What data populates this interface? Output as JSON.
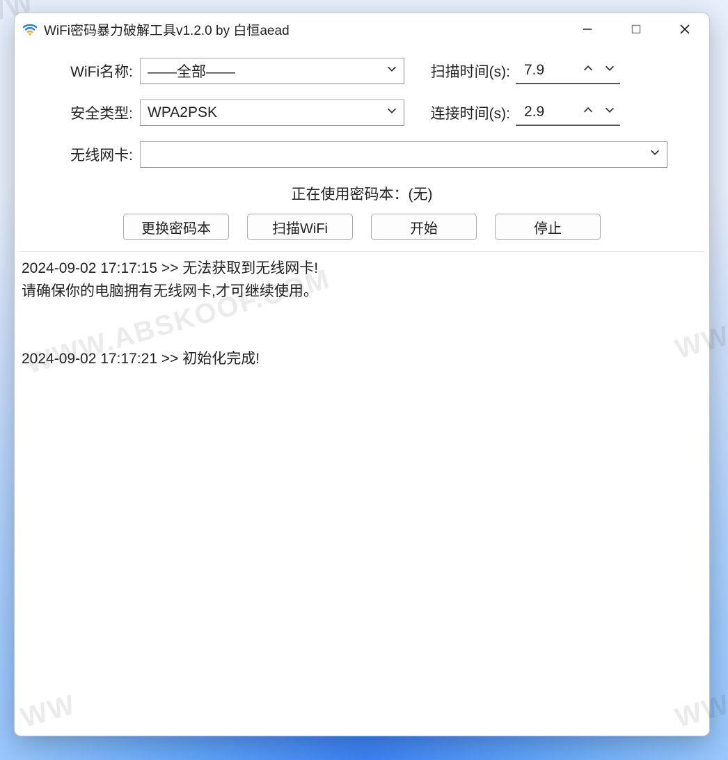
{
  "title": "WiFi密码暴力破解工具v1.2.0 by 白恒aead",
  "form": {
    "wifi_name_label": "WiFi名称:",
    "wifi_name_value": "——全部——",
    "security_label": "安全类型:",
    "security_value": "WPA2PSK",
    "adapter_label": "无线网卡:",
    "adapter_value": "",
    "scan_time_label": "扫描时间(s):",
    "scan_time_value": "7.9",
    "connect_time_label": "连接时间(s):",
    "connect_time_value": "2.9"
  },
  "status": "正在使用密码本：(无)",
  "buttons": {
    "change_dict": "更换密码本",
    "scan": "扫描WiFi",
    "start": "开始",
    "stop": "停止"
  },
  "log": "2024-09-02 17:17:15 >> 无法获取到无线网卡!\n请确保你的电脑拥有无线网卡,才可继续使用。\n\n\n2024-09-02 17:17:21 >> 初始化完成!",
  "watermark": "WWW.ABSKOOF.COM"
}
